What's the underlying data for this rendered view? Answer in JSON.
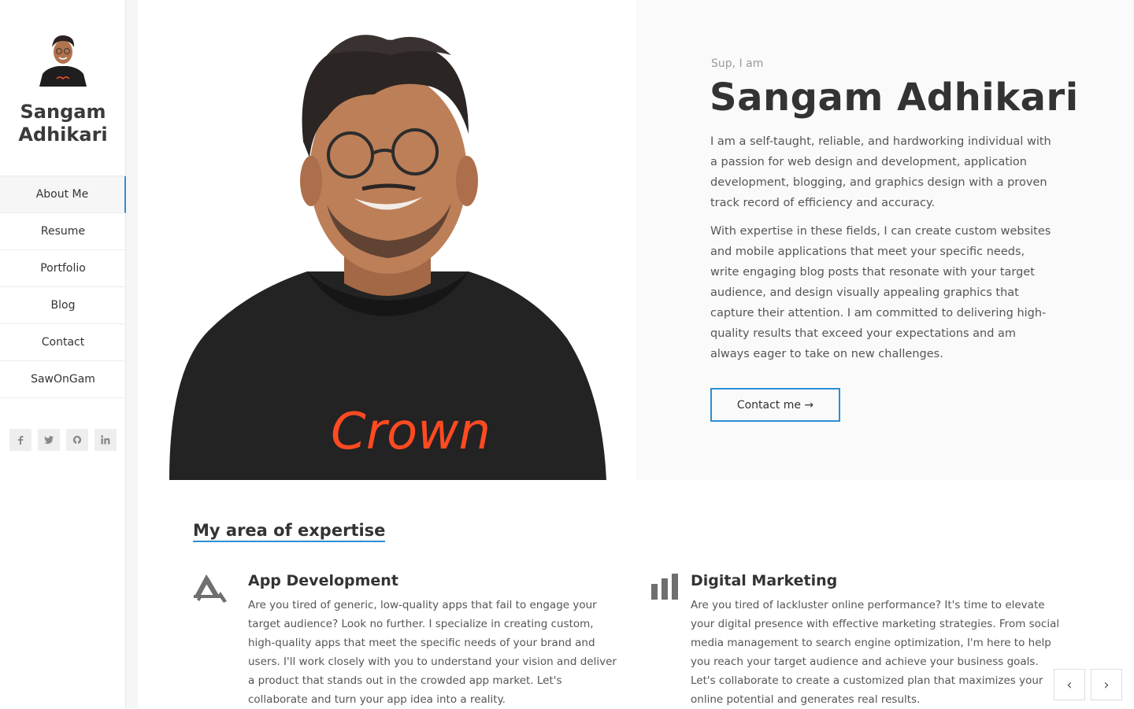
{
  "sidebar": {
    "name": "Sangam Adhikari",
    "nav": [
      {
        "label": "About Me",
        "active": true
      },
      {
        "label": "Resume"
      },
      {
        "label": "Portfolio"
      },
      {
        "label": "Blog"
      },
      {
        "label": "Contact"
      },
      {
        "label": "SawOnGam"
      }
    ],
    "social": [
      "facebook-icon",
      "twitter-icon",
      "github-icon",
      "linkedin-icon"
    ]
  },
  "hero": {
    "greeting": "Sup, I am",
    "name": "Sangam Adhikari",
    "paragraph1": "I am a self-taught, reliable, and hardworking individual with a passion for web design and development, application development, blogging, and graphics design with a proven track record of efficiency and accuracy.",
    "paragraph2": "With expertise in these fields, I can create custom websites and mobile applications that meet your specific needs, write engaging blog posts that resonate with your target audience, and design visually appealing graphics that capture their attention. I am committed to delivering high-quality results that exceed your expectations and am always eager to take on new challenges.",
    "contact_button": "Contact me →",
    "shirt_text": "Crown"
  },
  "expertise": {
    "title": "My area of expertise",
    "items": [
      {
        "icon": "app-store-icon",
        "title": "App Development",
        "text": "Are you tired of generic, low-quality apps that fail to engage your target audience? Look no further. I specialize in creating custom, high-quality apps that meet the specific needs of your brand and users. I'll work closely with you to understand your vision and deliver a product that stands out in the crowded app market. Let's collaborate and turn your app idea into a reality."
      },
      {
        "icon": "bar-chart-icon",
        "title": "Digital Marketing",
        "text": "Are you tired of lackluster online performance? It's time to elevate your digital presence with effective marketing strategies. From social media management to search engine optimization, I'm here to help you reach your target audience and achieve your business goals. Let's collaborate to create a customized plan that maximizes your online potential and generates real results."
      }
    ]
  },
  "pager": {
    "prev": "‹",
    "next": "›"
  },
  "colors": {
    "accent": "#2a8fd6",
    "panel": "#fafafa"
  }
}
